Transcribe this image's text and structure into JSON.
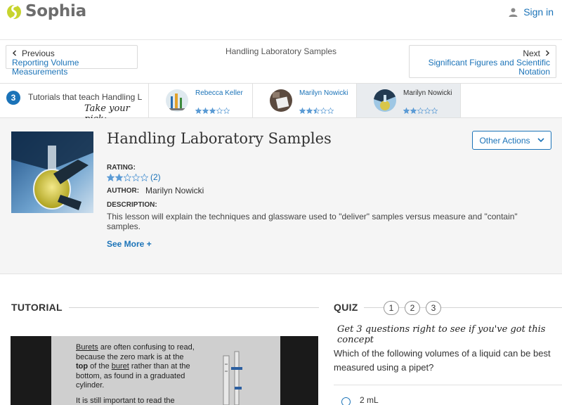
{
  "header": {
    "brand": "Sophia",
    "signin_label": "Sign in",
    "colors": {
      "brand_green": "#c7d42e",
      "link_blue": "#1b73b8"
    }
  },
  "nav": {
    "prev_label": "Previous",
    "prev_title": "Reporting Volume Measurements",
    "center_title": "Handling Laboratory Samples",
    "next_label": "Next",
    "next_title_line1": "Significant Figures and Scientific",
    "next_title_line2": "Notation"
  },
  "tutorials_strip": {
    "count": "3",
    "title": "Tutorials that teach Handling Laboratory Samples",
    "pick_text": "Take your pick:",
    "cards": [
      {
        "author": "Rebecca Keller",
        "stars": 3
      },
      {
        "author": "Marilyn Nowicki",
        "stars": 2.5
      },
      {
        "author": "Marilyn Nowicki",
        "stars": 2,
        "active": true
      }
    ]
  },
  "lesson": {
    "title": "Handling Laboratory Samples",
    "other_actions_label": "Other Actions",
    "rating_label": "RATING:",
    "rating_stars": 2,
    "rating_count": "(2)",
    "author_label": "AUTHOR:",
    "author": "Marilyn Nowicki",
    "description_label": "DESCRIPTION:",
    "description": "This lesson will explain the techniques and glassware used to \"deliver\" samples versus measure and \"contain\" samples.",
    "see_more_label": "See More +"
  },
  "tutorial": {
    "heading": "TUTORIAL",
    "slide_word_burets": "Burets",
    "slide_text_1": " are often confusing to read, because the zero mark is at the ",
    "slide_bold_top": "top",
    "slide_text_2": " of the ",
    "slide_word_buret": "buret",
    "slide_text_3": " rather than at the bottom, as found in a graduated cylinder.",
    "slide_text_4": "It is still important to read the"
  },
  "quiz": {
    "heading": "QUIZ",
    "numbers": [
      "1",
      "2",
      "3"
    ],
    "hint": "Get 3 questions right to see if you've got this concept",
    "question": "Which of the following volumes of a liquid can be best measured using a pipet?",
    "answers": [
      "2 mL"
    ]
  }
}
